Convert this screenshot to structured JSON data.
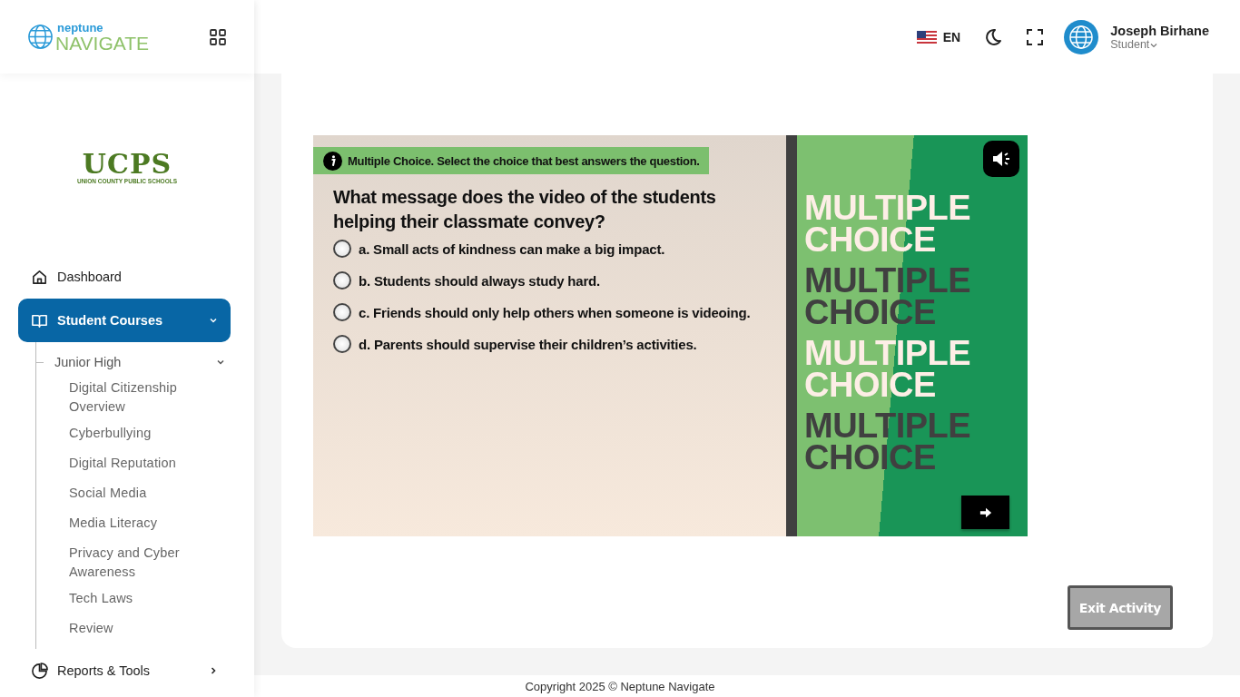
{
  "header": {
    "logo_top": "neptune",
    "logo_bottom": "NAVIGATE",
    "language": "EN",
    "user": {
      "name": "Joseph Birhane",
      "role": "Student"
    }
  },
  "sidebar": {
    "school_logo": {
      "initials": "UCPS",
      "name": "UNION COUNTY PUBLIC SCHOOLS"
    },
    "items": [
      {
        "label": "Dashboard",
        "selected": false
      },
      {
        "label": "Student Courses",
        "selected": true,
        "expanded": true,
        "children": [
          {
            "label": "Junior High",
            "expanded": true,
            "children": [
              {
                "label": "Digital Citizenship Overview"
              },
              {
                "label": "Cyberbullying"
              },
              {
                "label": "Digital Reputation"
              },
              {
                "label": "Social Media"
              },
              {
                "label": "Media Literacy"
              },
              {
                "label": "Privacy and Cyber Awareness"
              },
              {
                "label": "Tech Laws"
              },
              {
                "label": "Review"
              }
            ]
          }
        ]
      },
      {
        "label": "Reports & Tools",
        "selected": false,
        "expanded": false
      }
    ]
  },
  "activity": {
    "instruction": "Multiple Choice. Select the choice that best answers the question.",
    "question": "What message does the video of the students helping their classmate convey?",
    "choices": [
      {
        "label": "a. Small acts of kindness can make a big impact.",
        "selected": false
      },
      {
        "label": "b. Students should always study hard.",
        "selected": false
      },
      {
        "label": "c. Friends should only help others when someone is videoing.",
        "selected": false
      },
      {
        "label": "d. Parents should supervise their children’s activities.",
        "selected": false
      }
    ],
    "banner": [
      {
        "text": "MULTIPLE CHOICE",
        "color": "#fdeee6"
      },
      {
        "text": "MULTIPLE CHOICE",
        "color": "#404040"
      },
      {
        "text": "MULTIPLE CHOICE",
        "color": "#fdeee6"
      },
      {
        "text": "MULTIPLE CHOICE",
        "color": "#404040"
      }
    ],
    "exit_button": "Exit Activity"
  },
  "footer": {
    "copyright": "Copyright 2025 © Neptune Navigate"
  }
}
